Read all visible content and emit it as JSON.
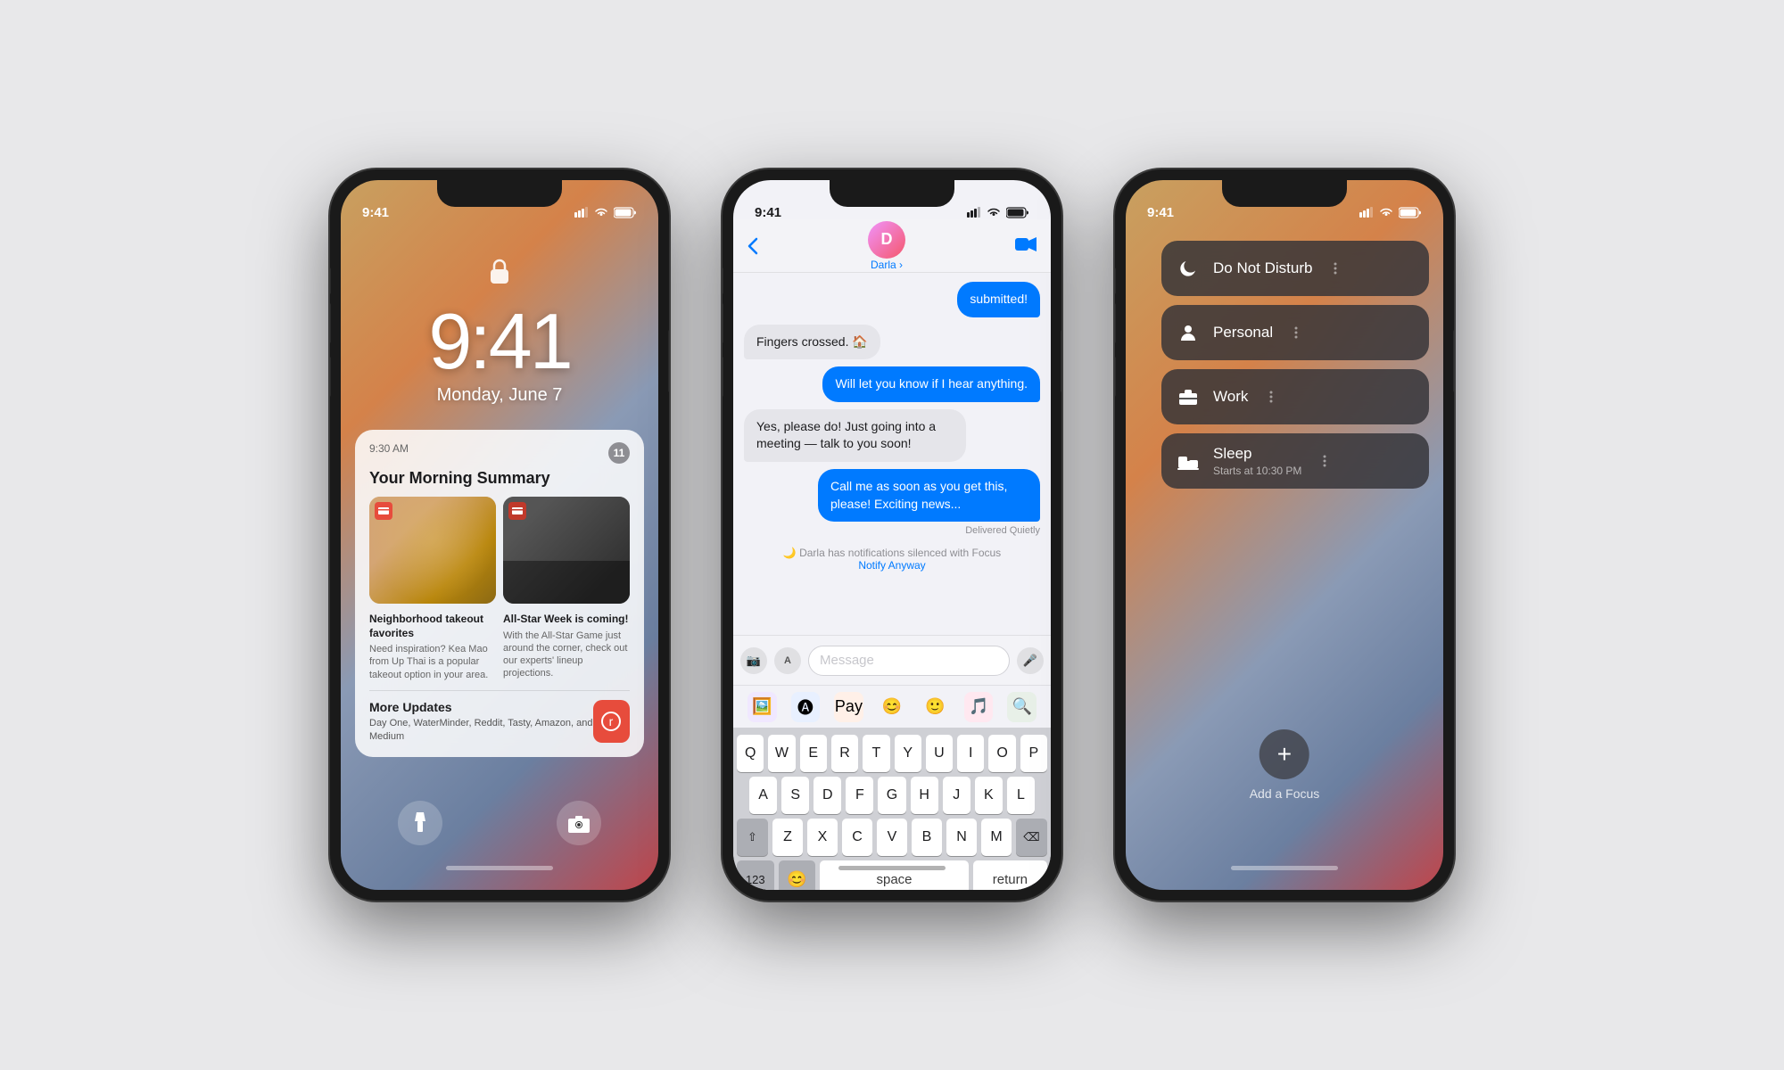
{
  "background_color": "#e8e8ea",
  "phone1": {
    "status_time": "9:41",
    "lock_time": "9:41",
    "lock_date": "Monday, June 7",
    "notification": {
      "time": "9:30 AM",
      "badge_count": "11",
      "title": "Your Morning Summary",
      "article1_title": "Neighborhood takeout favorites",
      "article1_body": "Need inspiration? Kea Mao from Up Thai is a popular takeout option in your area.",
      "article2_title": "All-Star Week is coming!",
      "article2_body": "With the All-Star Game just around the corner, check out our experts' lineup projections.",
      "more_title": "More Updates",
      "more_body": "Day One, WaterMinder, Reddit, Tasty, Amazon, and Medium"
    }
  },
  "phone2": {
    "status_time": "9:41",
    "contact_name": "Darla",
    "contact_name_sub": "Darla ›",
    "messages": [
      {
        "type": "sent",
        "text": "submitted!"
      },
      {
        "type": "received",
        "text": "Fingers crossed. 🏠"
      },
      {
        "type": "sent",
        "text": "Will let you know if I hear anything."
      },
      {
        "type": "received",
        "text": "Yes, please do! Just going into a meeting — talk to you soon!"
      },
      {
        "type": "sent",
        "text": "Call me as soon as you get this, please! Exciting news..."
      }
    ],
    "delivered_quietly": "Delivered Quietly",
    "focus_notice": "🌙 Darla has notifications silenced with Focus",
    "notify_anyway": "Notify Anyway",
    "input_placeholder": "Message",
    "keyboard_row1": [
      "Q",
      "W",
      "E",
      "R",
      "T",
      "Y",
      "U",
      "I",
      "O",
      "P"
    ],
    "keyboard_row2": [
      "A",
      "S",
      "D",
      "F",
      "G",
      "H",
      "J",
      "K",
      "L"
    ],
    "keyboard_row3": [
      "Z",
      "X",
      "C",
      "V",
      "B",
      "N",
      "M"
    ],
    "key_123": "123",
    "key_space": "space",
    "key_return": "return"
  },
  "phone3": {
    "status_time": "9:41",
    "focus_items": [
      {
        "icon": "moon",
        "label": "Do Not Disturb",
        "sub": ""
      },
      {
        "icon": "person",
        "label": "Personal",
        "sub": ""
      },
      {
        "icon": "briefcase",
        "label": "Work",
        "sub": ""
      },
      {
        "icon": "bed",
        "label": "Sleep",
        "sub": "Starts at 10:30 PM"
      }
    ],
    "add_label": "Add a Focus"
  }
}
